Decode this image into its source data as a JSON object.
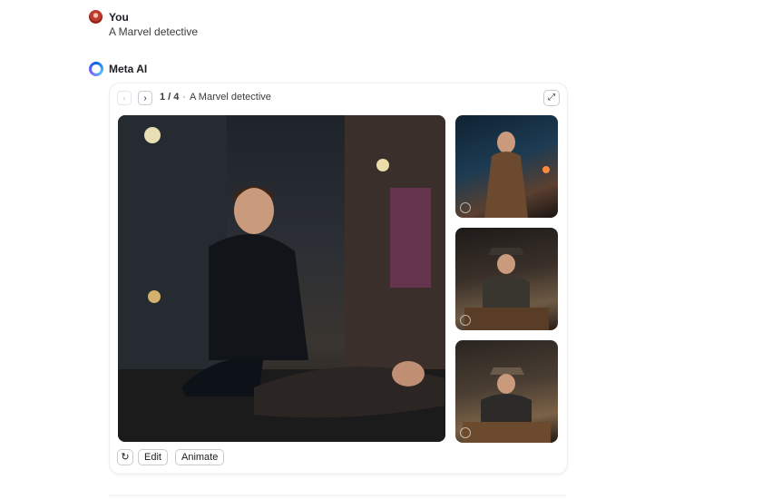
{
  "user": {
    "sender": "You",
    "text": "A Marvel detective"
  },
  "assistant": {
    "sender": "Meta AI"
  },
  "gallery": {
    "counter": "1 / 4",
    "separator": "·",
    "title": "A Marvel detective",
    "prev_icon": "chevron-left-icon",
    "next_icon": "chevron-right-icon",
    "expand_icon": "expand-icon",
    "images": [
      {
        "id": "main",
        "description_icon": "image"
      },
      {
        "id": "thumb-1"
      },
      {
        "id": "thumb-2"
      },
      {
        "id": "thumb-3"
      }
    ]
  },
  "actions": {
    "refresh_icon": "refresh-icon",
    "edit_label": "Edit",
    "animate_label": "Animate"
  }
}
